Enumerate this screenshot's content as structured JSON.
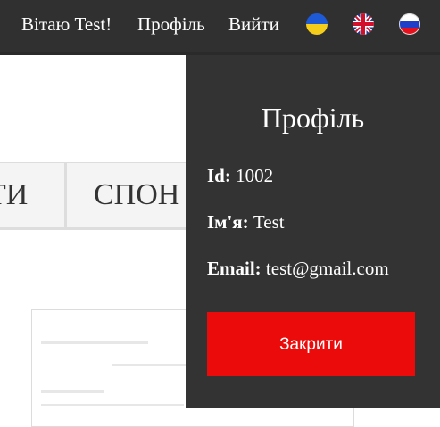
{
  "header": {
    "greeting": "Вітаю Test!",
    "profile_link": "Профіль",
    "logout_link": "Вийти",
    "languages": [
      {
        "icon": "ukraine-flag-icon"
      },
      {
        "icon": "uk-flag-icon"
      },
      {
        "icon": "russia-flag-icon"
      }
    ],
    "bar_color": "#303030"
  },
  "nav": {
    "items": [
      {
        "label": "ТИ"
      },
      {
        "label": "СПОН"
      }
    ]
  },
  "profile_panel": {
    "title": "Профіль",
    "fields": [
      {
        "key": "Id:",
        "value": "1002"
      },
      {
        "key": "Ім'я:",
        "value": "Test"
      },
      {
        "key": "Email:",
        "value": "test@gmail.com"
      }
    ],
    "close_label": "Закрити",
    "close_color": "#ec0b0b",
    "background_color": "#333333"
  }
}
